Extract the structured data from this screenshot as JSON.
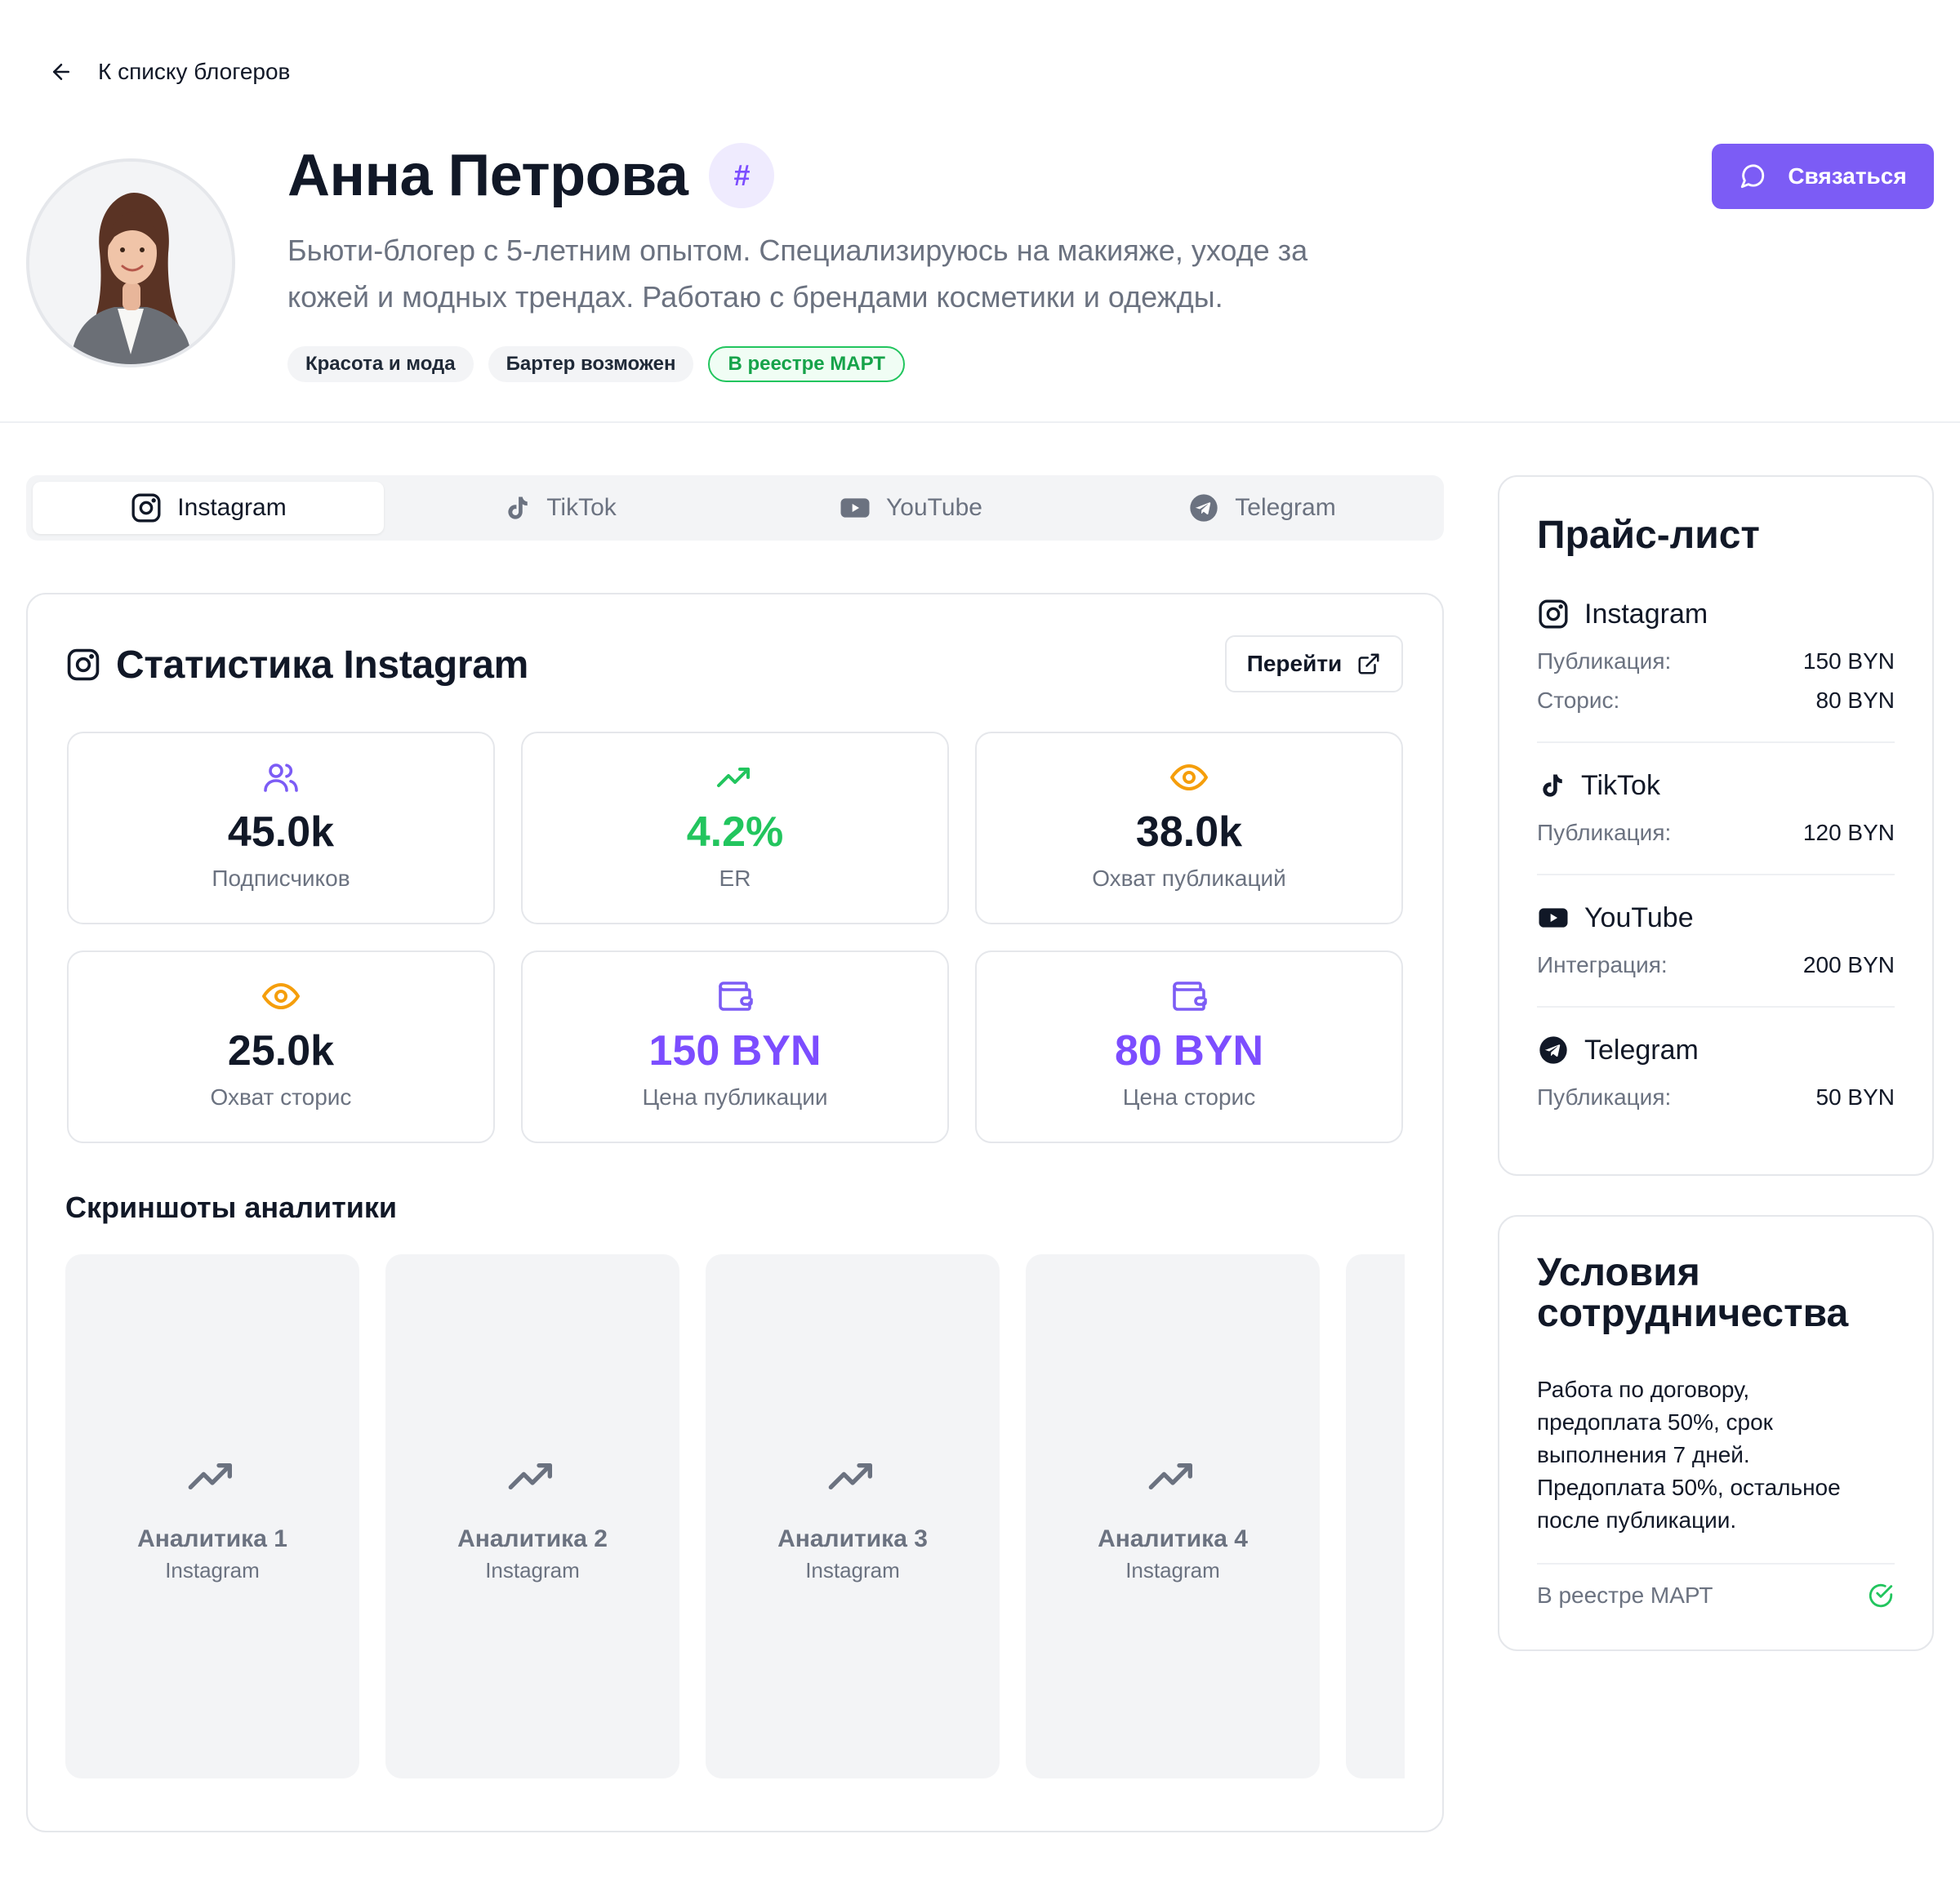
{
  "nav": {
    "back_label": "К списку блогеров"
  },
  "profile": {
    "name": "Анна Петрова",
    "hash_badge": "#",
    "bio_line1": "Бьюти-блогер с 5-летним опытом. Специализируюсь на макияже, уходе за",
    "bio_line2": "кожей и модных трендах. Работаю с брендами косметики и одежды.",
    "tags": [
      "Красота и мода",
      "Бартер возможен",
      "В реестре МАРТ"
    ],
    "contact_label": "Связаться"
  },
  "colors": {
    "accent": "#7c5cf5",
    "success": "#22c55e",
    "warning": "#f59e0b",
    "muted": "#6b7280"
  },
  "tabs": [
    {
      "label": "Instagram",
      "icon": "instagram-icon",
      "active": true
    },
    {
      "label": "TikTok",
      "icon": "tiktok-icon",
      "active": false
    },
    {
      "label": "YouTube",
      "icon": "youtube-icon",
      "active": false
    },
    {
      "label": "Telegram",
      "icon": "telegram-icon",
      "active": false
    }
  ],
  "stats": {
    "title": "Статистика Instagram",
    "goto_label": "Перейти",
    "metrics": [
      {
        "value": "45.0k",
        "label": "Подписчиков",
        "icon": "users-icon"
      },
      {
        "value": "4.2%",
        "label": "ER",
        "icon": "trending-up-icon"
      },
      {
        "value": "38.0k",
        "label": "Охват публикаций",
        "icon": "eye-icon"
      },
      {
        "value": "25.0k",
        "label": "Охват сторис",
        "icon": "eye-icon"
      },
      {
        "value": "150 BYN",
        "label": "Цена публикации",
        "icon": "wallet-icon"
      },
      {
        "value": "80 BYN",
        "label": "Цена сторис",
        "icon": "wallet-icon"
      }
    ]
  },
  "screenshots": {
    "title": "Скриншоты аналитики",
    "items": [
      {
        "title": "Аналитика 1",
        "sub": "Instagram"
      },
      {
        "title": "Аналитика 2",
        "sub": "Instagram"
      },
      {
        "title": "Аналитика 3",
        "sub": "Instagram"
      },
      {
        "title": "Аналитика 4",
        "sub": "Instagram"
      }
    ]
  },
  "pricelist": {
    "title": "Прайс-лист",
    "platforms": [
      {
        "name": "Instagram",
        "rows": [
          {
            "k": "Публикация:",
            "v": "150 BYN"
          },
          {
            "k": "Сторис:",
            "v": "80 BYN"
          }
        ]
      },
      {
        "name": "TikTok",
        "rows": [
          {
            "k": "Публикация:",
            "v": "120 BYN"
          }
        ]
      },
      {
        "name": "YouTube",
        "rows": [
          {
            "k": "Интеграция:",
            "v": "200 BYN"
          }
        ]
      },
      {
        "name": "Telegram",
        "rows": [
          {
            "k": "Публикация:",
            "v": "50 BYN"
          }
        ]
      }
    ]
  },
  "terms": {
    "title_line1": "Условия",
    "title_line2": "сотрудничества",
    "text_lines": [
      "Работа по договору,",
      "предоплата 50%, срок",
      "выполнения 7 дней.",
      "Предоплата 50%, остальное",
      "после публикации."
    ],
    "registry_label": "В реестре МАРТ"
  }
}
